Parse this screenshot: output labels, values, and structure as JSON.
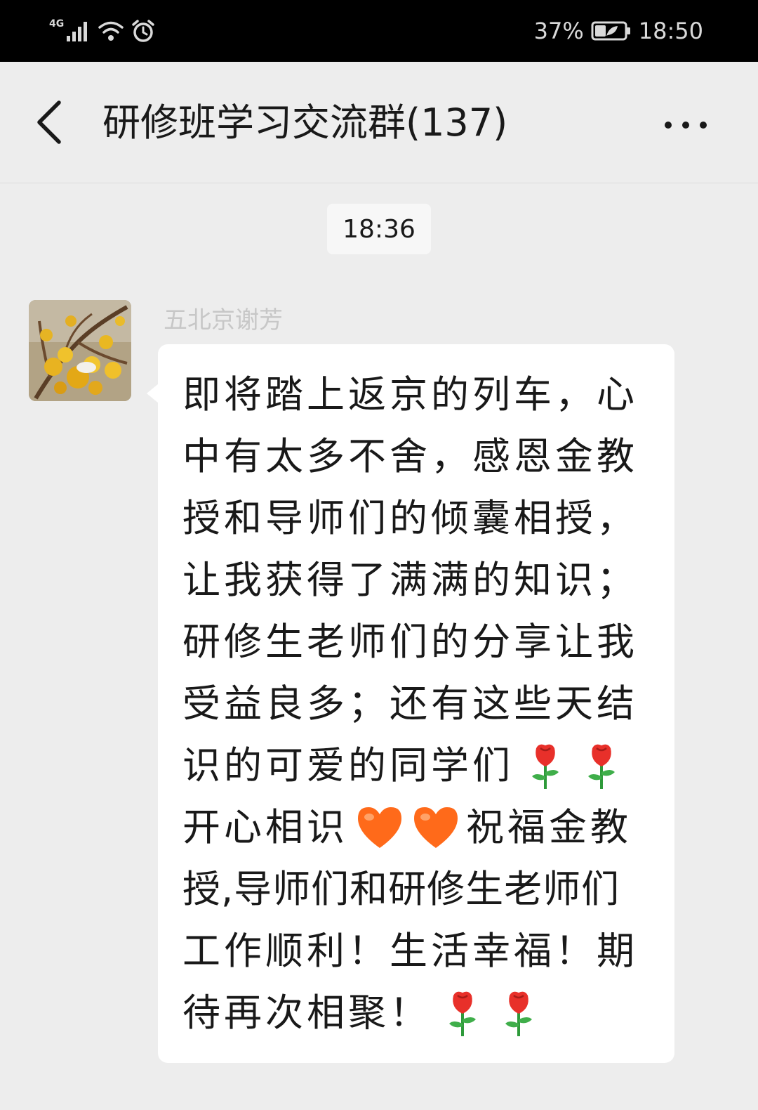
{
  "status_bar": {
    "network": "4G",
    "battery_percent": "37%",
    "battery_level": 0.37,
    "time": "18:50"
  },
  "nav": {
    "title": "研修班学习交流群(137)",
    "back_icon": "chevron-left-icon",
    "more_icon": "more-dots-icon"
  },
  "chat": {
    "timestamp": "18:36",
    "message": {
      "sender": "五北京谢芳",
      "avatar": "wintersweet-blossom-avatar",
      "lines": [
        {
          "text": "即将踏上返京的列车，心"
        },
        {
          "text": "中有太多不舍，感恩金教"
        },
        {
          "text": "授和导师们的倾囊相授，"
        },
        {
          "text": "让我获得了满满的知识；"
        },
        {
          "text": "研修生老师们的分享让我"
        },
        {
          "text": "受益良多；还有这些天结"
        },
        {
          "text": "识的可爱的同学们",
          "emoji_after": [
            "rose",
            "rose"
          ]
        },
        {
          "text": "开心相识",
          "emoji_after": [
            "heart",
            "heart"
          ],
          "text_after": "祝福金教"
        },
        {
          "text": "授,导师们和研修生老师们"
        },
        {
          "text": "工作顺利！生活幸福！期"
        },
        {
          "text": "待再次相聚！",
          "emoji_after": [
            "rose",
            "rose"
          ]
        }
      ]
    }
  },
  "colors": {
    "status_bar": "#000000",
    "background": "#ededed",
    "bubble": "#ffffff",
    "text": "#191919",
    "sender_name": "#c7c7c7",
    "heart": "#ff6a1a",
    "rose": "#e8302a"
  }
}
